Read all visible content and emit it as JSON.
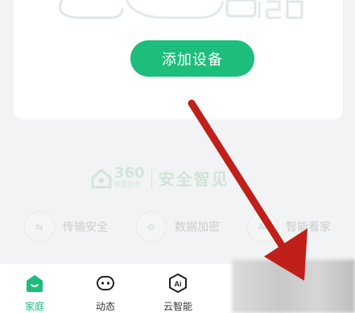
{
  "card": {
    "add_button_label": "添加设备"
  },
  "brand": {
    "name": "360",
    "sub": "智慧生活",
    "slogan": "安全智见"
  },
  "features": [
    {
      "icon": "transfer-icon",
      "label": "传输安全"
    },
    {
      "icon": "lock-icon",
      "label": "数据加密"
    },
    {
      "icon": "ai-icon",
      "label": "智能看家"
    }
  ],
  "tabbar": {
    "tabs": [
      {
        "label": "家庭",
        "icon": "home-icon",
        "active": true
      },
      {
        "label": "动态",
        "icon": "message-icon",
        "active": false
      },
      {
        "label": "云智能",
        "icon": "ai-cloud-icon",
        "active": false
      }
    ]
  },
  "colors": {
    "accent": "#1dbd7c",
    "arrow": "#c0201a"
  }
}
